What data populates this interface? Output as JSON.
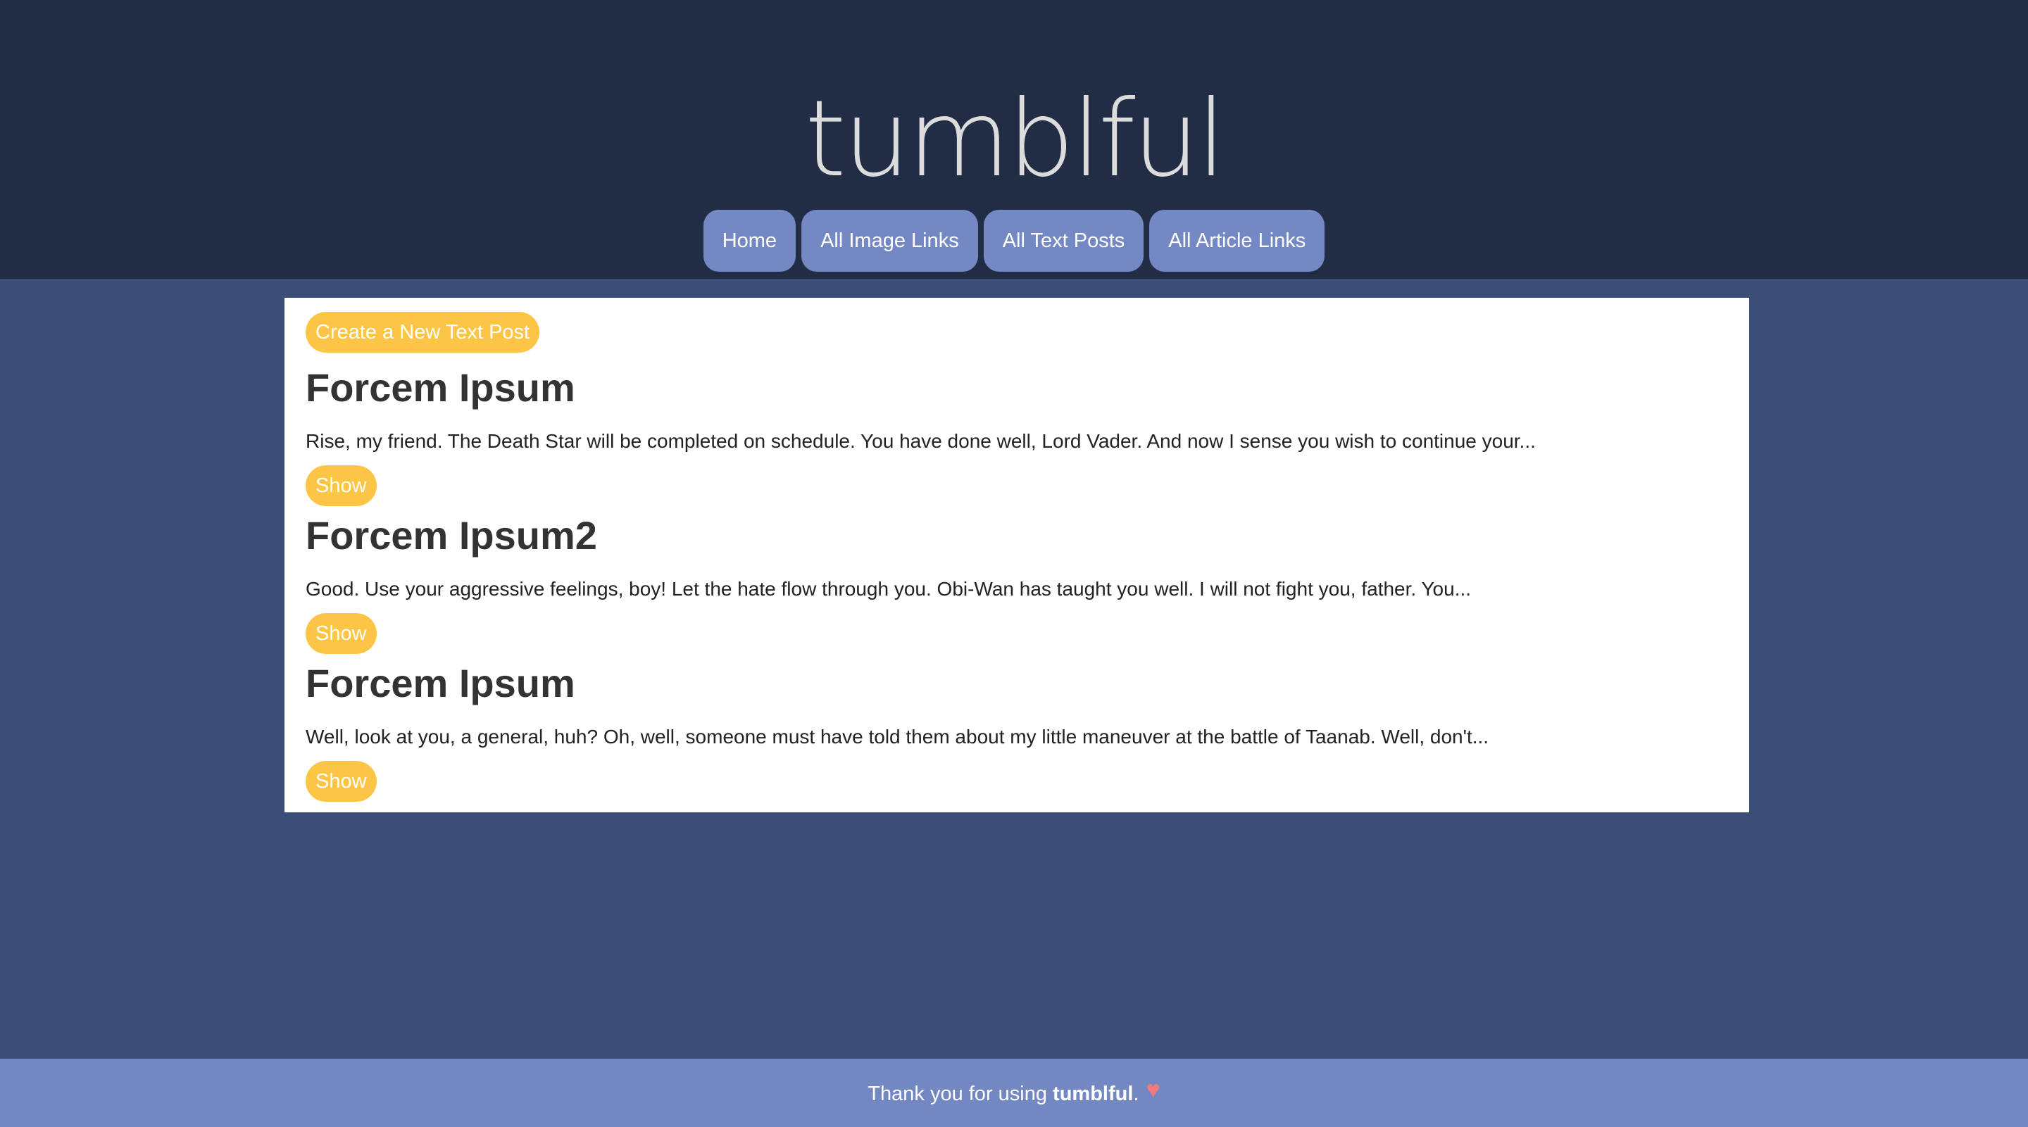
{
  "header": {
    "site_title": "tumblful",
    "nav": [
      {
        "label": "Home"
      },
      {
        "label": "All Image Links"
      },
      {
        "label": "All Text Posts"
      },
      {
        "label": "All Article Links"
      }
    ]
  },
  "main": {
    "create_button_label": "Create a New Text Post",
    "posts": [
      {
        "title": "Forcem Ipsum",
        "excerpt": "Rise, my friend. The Death Star will be completed on schedule. You have done well, Lord Vader. And now I sense you wish to continue your...",
        "show_label": "Show"
      },
      {
        "title": "Forcem Ipsum2",
        "excerpt": "Good. Use your aggressive feelings, boy! Let the hate flow through you. Obi-Wan has taught you well. I will not fight you, father. You...",
        "show_label": "Show"
      },
      {
        "title": "Forcem Ipsum",
        "excerpt": "Well, look at you, a general, huh? Oh, well, someone must have told them about my little maneuver at the battle of Taanab. Well, don't...",
        "show_label": "Show"
      }
    ]
  },
  "footer": {
    "text_before": "Thank you for using ",
    "brand": "tumblful",
    "text_after": ".",
    "heart_icon": "heart-icon"
  },
  "colors": {
    "header_bg": "#212c45",
    "body_bg": "#3a4e77",
    "nav_button": "#7488c4",
    "accent_yellow": "#fdc545",
    "footer_bg": "#7388c3",
    "heart": "#f07b7b"
  }
}
